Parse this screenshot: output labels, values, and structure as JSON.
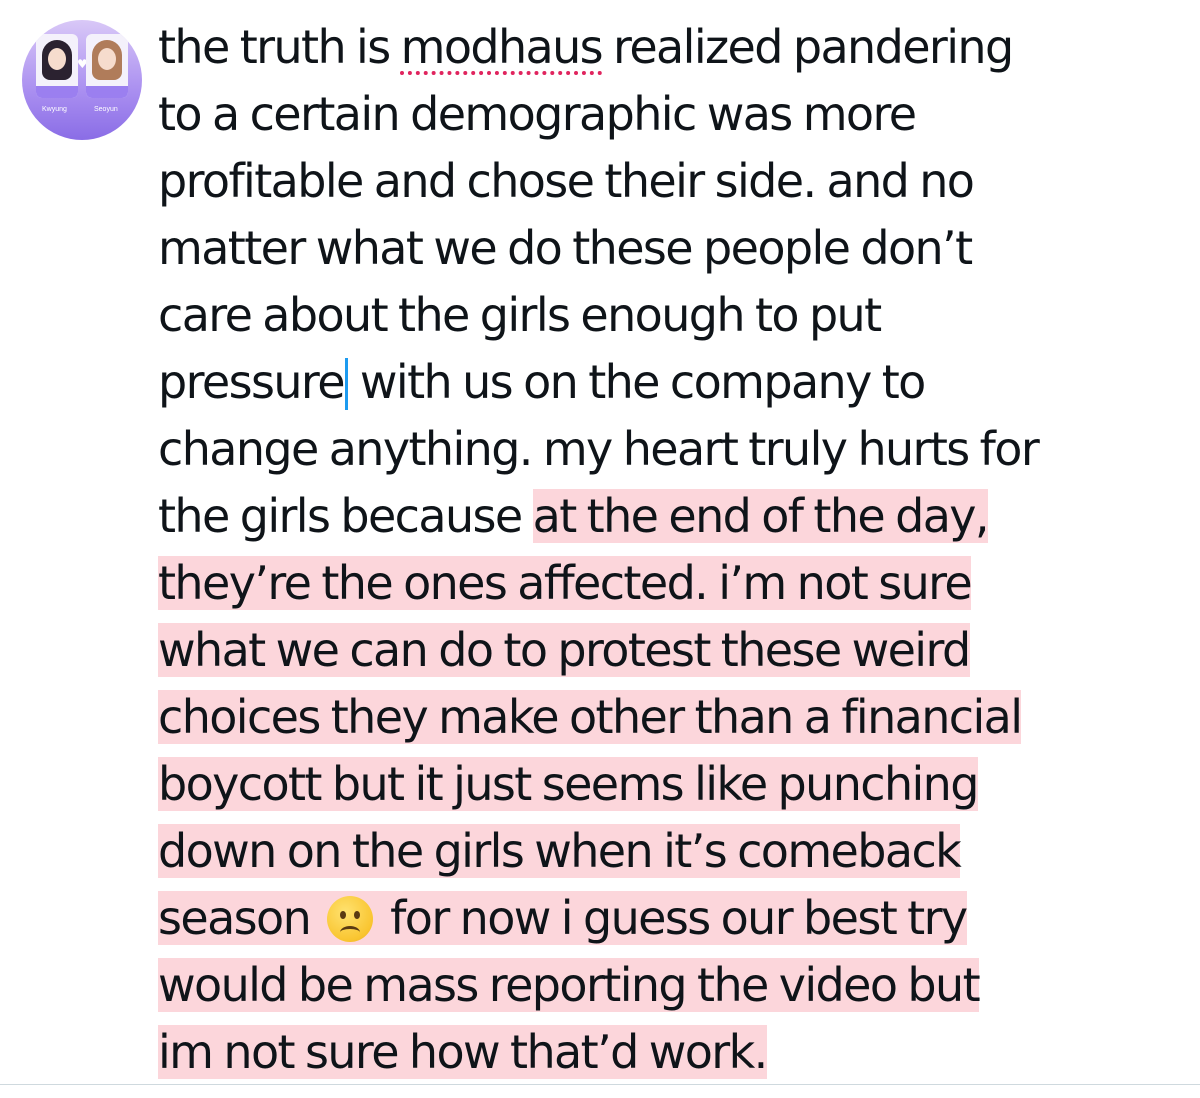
{
  "avatar": {
    "left_name": "Kwyung",
    "right_name": "Seoyun",
    "heart": "♥"
  },
  "tweet": {
    "lines": [
      {
        "parts": [
          {
            "text": "the truth is "
          },
          {
            "text": "modhaus",
            "misspelled": true
          },
          {
            "text": " realized pandering"
          }
        ]
      },
      {
        "parts": [
          {
            "text": "to a certain demographic was more"
          }
        ]
      },
      {
        "parts": [
          {
            "text": "profitable and chose their side. and no"
          }
        ]
      },
      {
        "parts": [
          {
            "text": "matter what we do these people don’t"
          }
        ]
      },
      {
        "parts": [
          {
            "text": "care about the girls enough to put"
          }
        ]
      },
      {
        "parts": [
          {
            "text": "pressure"
          },
          {
            "cursor": true
          },
          {
            "text": " with us on the company to"
          }
        ]
      },
      {
        "parts": [
          {
            "text": "change anything. my heart truly hurts for"
          }
        ]
      },
      {
        "parts": [
          {
            "text": "the girls because "
          },
          {
            "text": "at the end of the day,",
            "highlight": true
          }
        ]
      },
      {
        "parts": [
          {
            "text": "they’re the ones affected. i’m not sure",
            "highlight": true
          }
        ]
      },
      {
        "parts": [
          {
            "text": "what we can do to protest these weird",
            "highlight": true
          }
        ]
      },
      {
        "parts": [
          {
            "text": "choices they make other than a financial",
            "highlight": true
          }
        ]
      },
      {
        "parts": [
          {
            "text": "boycott but it just seems like punching",
            "highlight": true
          }
        ]
      },
      {
        "parts": [
          {
            "text": "down on the girls when it’s comeback",
            "highlight": true
          }
        ]
      },
      {
        "parts": [
          {
            "text": "season ",
            "highlight": true
          },
          {
            "emoji": "frowning-face",
            "highlight": true
          },
          {
            "text": " for now i guess our best try",
            "highlight": true
          }
        ]
      },
      {
        "parts": [
          {
            "text": "would be mass reporting the video but",
            "highlight": true
          }
        ]
      },
      {
        "parts": [
          {
            "text": "im not sure how that’d work.",
            "highlight": true
          }
        ]
      }
    ]
  },
  "colors": {
    "text": "#0f1419",
    "highlight": "#fcd6db",
    "cursor": "#1d9bf0",
    "spellcheck": "#e0245e",
    "divider": "#cfd9de"
  }
}
